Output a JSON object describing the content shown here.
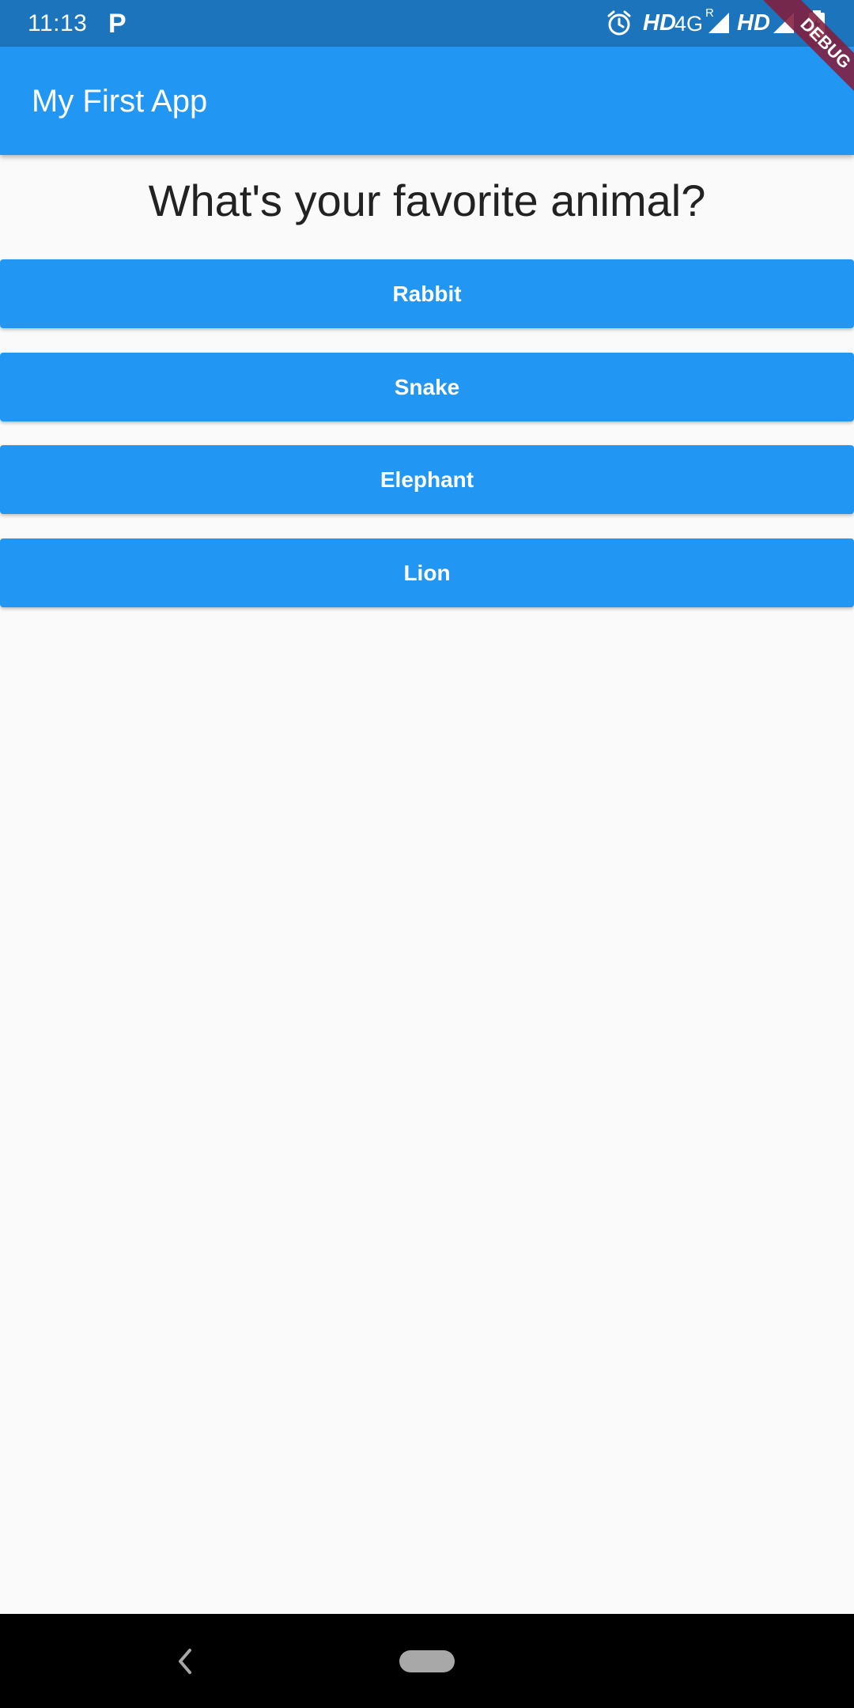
{
  "status_bar": {
    "time": "11:13",
    "notification_glyph": "P",
    "hd_1": "HD",
    "network": "4G",
    "roaming": "R",
    "hd_2": "HD",
    "icons": [
      "alarm-icon",
      "signal-icon",
      "battery-charging-icon"
    ]
  },
  "app_bar": {
    "title": "My First App"
  },
  "debug_banner": {
    "label": "DEBUG"
  },
  "main": {
    "question": "What's your favorite animal?",
    "answers": [
      "Rabbit",
      "Snake",
      "Elephant",
      "Lion"
    ]
  },
  "nav_bar": {
    "icons": [
      "back-icon",
      "home-pill-icon"
    ]
  },
  "colors": {
    "primary": "#2196f3",
    "status_bar": "#1c75bc",
    "background": "#fafafa",
    "debug_banner": "#821e3c"
  }
}
